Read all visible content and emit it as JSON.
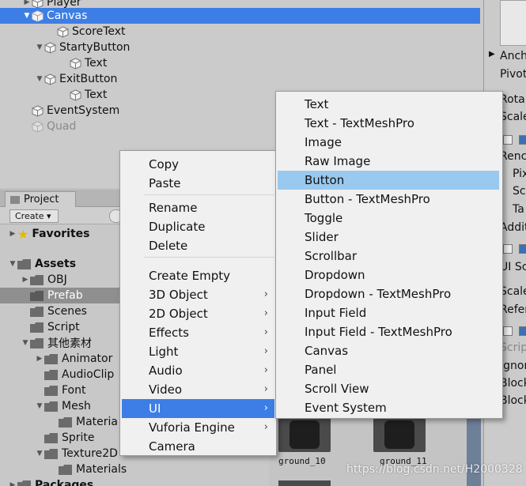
{
  "hierarchy": {
    "items": [
      {
        "label": "Player"
      },
      {
        "label": "Canvas"
      },
      {
        "label": "ScoreText"
      },
      {
        "label": "StartyButton"
      },
      {
        "label": "Text"
      },
      {
        "label": "ExitButton"
      },
      {
        "label": "Text"
      },
      {
        "label": "EventSystem"
      },
      {
        "label": "Quad"
      }
    ]
  },
  "project": {
    "tab_label": "Project",
    "create_label": "Create ▾",
    "favorites_label": "Favorites",
    "assets_label": "Assets",
    "folders": [
      "OBJ",
      "Prefab",
      "Scenes",
      "Script",
      "其他素材",
      "Animator",
      "AudioClip",
      "Font",
      "Mesh",
      "Materia",
      "Sprite",
      "Texture2D",
      "Materials"
    ],
    "packages_label": "Packages"
  },
  "context_menu": {
    "items": [
      "Copy",
      "Paste",
      "Rename",
      "Duplicate",
      "Delete",
      "Create Empty",
      "3D Object",
      "2D Object",
      "Effects",
      "Light",
      "Audio",
      "Video",
      "UI",
      "Vuforia Engine",
      "Camera"
    ],
    "selected": "UI"
  },
  "ui_submenu": {
    "items": [
      "Text",
      "Text - TextMeshPro",
      "Image",
      "Raw Image",
      "Button",
      "Button - TextMeshPro",
      "Toggle",
      "Slider",
      "Scrollbar",
      "Dropdown",
      "Dropdown - TextMeshPro",
      "Input Field",
      "Input Field - TextMeshPro",
      "Canvas",
      "Panel",
      "Scroll View",
      "Event System"
    ],
    "selected": "Button"
  },
  "inspector": {
    "labels": [
      "Anch",
      "Pivot",
      "Rota",
      "Scale",
      "Renc",
      "Pix",
      "Sc",
      "Ta",
      "Addit",
      "UI Sc",
      "Scale",
      "Refer",
      "Scrip",
      "Ignor",
      "Block",
      "Block"
    ]
  },
  "assets": {
    "thumb_labels": [
      "ground_10",
      "ground_11"
    ]
  },
  "watermark": "https://blog.csdn.net/H2000328",
  "colors": {
    "selection_blue": "#3d7ee6",
    "submenu_highlight": "#99c9ef",
    "menu_bg": "#f0f0f0",
    "panel_bg": "#cbcbcb"
  }
}
